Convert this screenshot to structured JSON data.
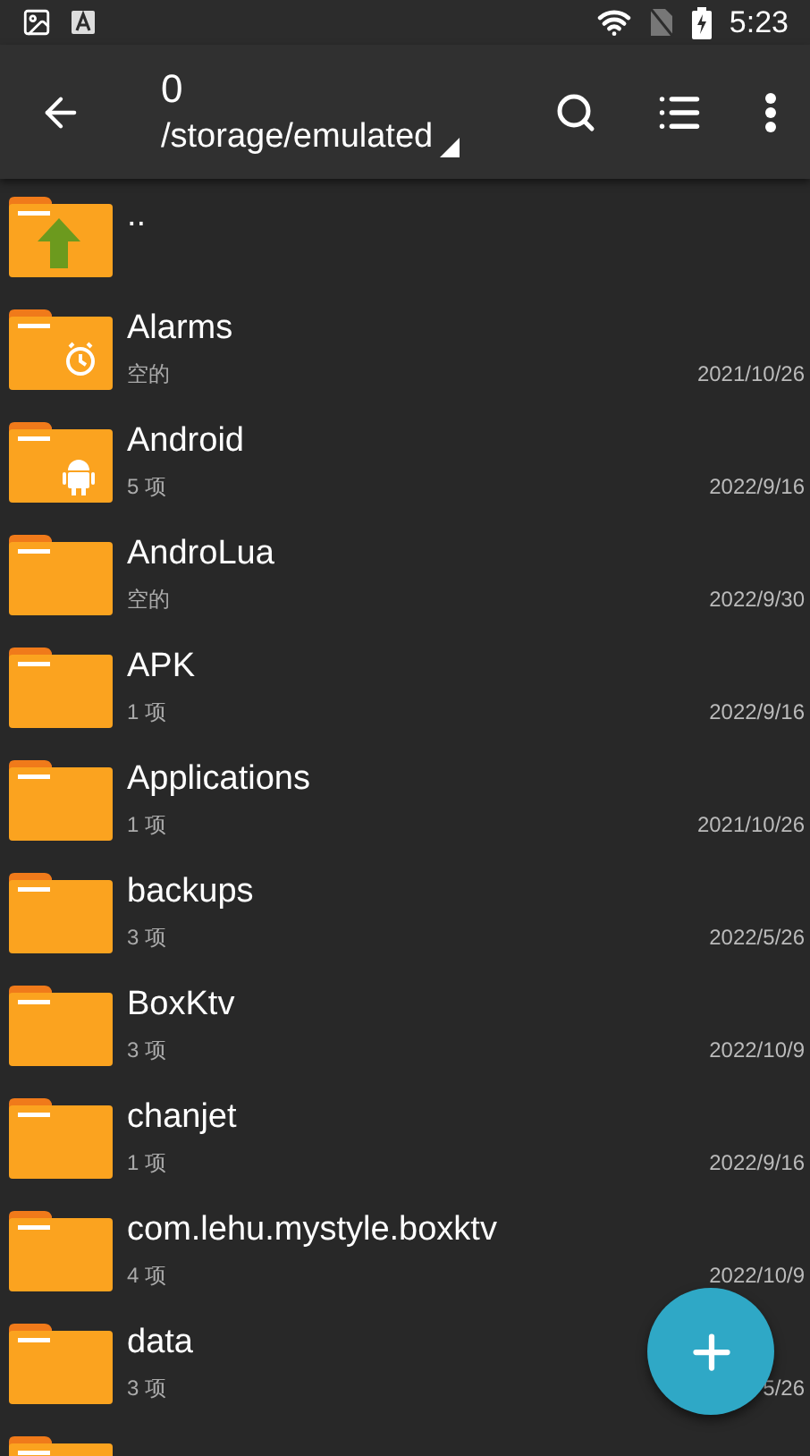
{
  "status_bar": {
    "time": "5:23"
  },
  "toolbar": {
    "title": "0",
    "path": "/storage/emulated"
  },
  "files": [
    {
      "kind": "parent",
      "name": ".."
    },
    {
      "kind": "alarm",
      "name": "Alarms",
      "meta": "空的",
      "date": "2021/10/26"
    },
    {
      "kind": "android",
      "name": "Android",
      "meta": "5 项",
      "date": "2022/9/16"
    },
    {
      "kind": "folder",
      "name": "AndroLua",
      "meta": "空的",
      "date": "2022/9/30"
    },
    {
      "kind": "folder",
      "name": "APK",
      "meta": "1 项",
      "date": "2022/9/16"
    },
    {
      "kind": "folder",
      "name": "Applications",
      "meta": "1 项",
      "date": "2021/10/26"
    },
    {
      "kind": "folder",
      "name": "backups",
      "meta": "3 项",
      "date": "2022/5/26"
    },
    {
      "kind": "folder",
      "name": "BoxKtv",
      "meta": "3 项",
      "date": "2022/10/9"
    },
    {
      "kind": "folder",
      "name": "chanjet",
      "meta": "1 项",
      "date": "2022/9/16"
    },
    {
      "kind": "folder",
      "name": "com.lehu.mystyle.boxktv",
      "meta": "4 项",
      "date": "2022/10/9"
    },
    {
      "kind": "folder",
      "name": "data",
      "meta": "3 项",
      "date": "5/26"
    },
    {
      "kind": "folder"
    }
  ]
}
